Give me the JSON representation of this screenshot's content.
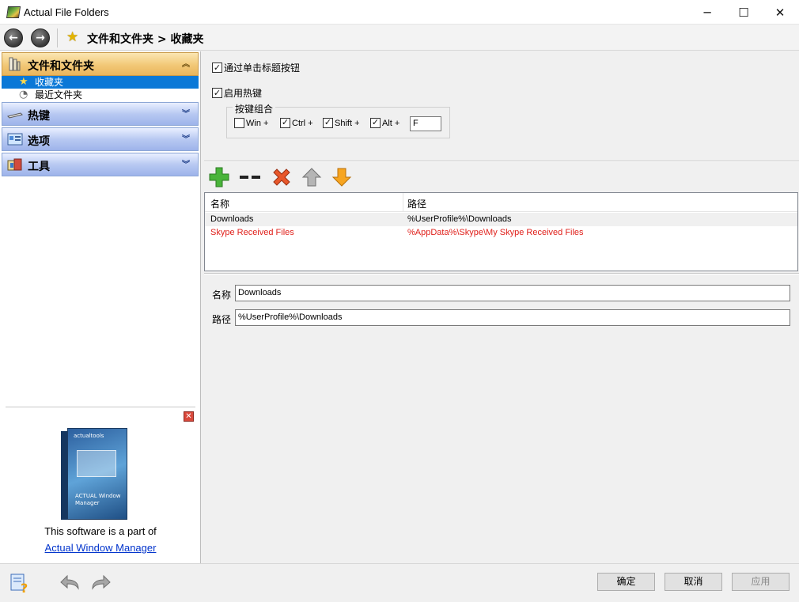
{
  "window": {
    "title": "Actual File Folders",
    "minimize": "─",
    "maximize": "☐",
    "close": "✕"
  },
  "nav": {
    "back_glyph": "←",
    "forward_glyph": "→",
    "breadcrumb": "文件和文件夹 > 收藏夹"
  },
  "sidebar": {
    "categories": [
      {
        "label": "文件和文件夹",
        "icon": "folder-icon",
        "expanded": true
      },
      {
        "label": "热键",
        "icon": "keyboard-icon",
        "expanded": false
      },
      {
        "label": "选项",
        "icon": "options-icon",
        "expanded": false
      },
      {
        "label": "工具",
        "icon": "tools-icon",
        "expanded": false
      }
    ],
    "items": [
      {
        "label": "收藏夹",
        "icon": "star-icon",
        "selected": true
      },
      {
        "label": "最近文件夹",
        "icon": "clock-icon",
        "selected": false
      }
    ],
    "chevron_up": "︽",
    "chevron_down": "︾"
  },
  "promo": {
    "close": "✕",
    "text": "This software is a part of",
    "link": "Actual Window Manager",
    "box_logo": "actualtools",
    "box_title": "ACTUAL Window Manager"
  },
  "settings": {
    "title_button_label": "通过单击标题按钮",
    "title_button_checked": true,
    "hotkey_label": "启用热键",
    "hotkey_checked": true,
    "hotkey_group_label": "按键组合",
    "modifiers": [
      {
        "label": "Win +",
        "checked": false
      },
      {
        "label": "Ctrl +",
        "checked": true
      },
      {
        "label": "Shift +",
        "checked": true
      },
      {
        "label": "Alt +",
        "checked": true
      }
    ],
    "key": "F"
  },
  "table": {
    "columns": [
      "名称",
      "路径"
    ],
    "rows": [
      {
        "name": "Downloads",
        "path": "%UserProfile%\\Downloads",
        "color": "#000000"
      },
      {
        "name": "Skype Received Files",
        "path": "%AppData%\\Skype\\My Skype Received Files",
        "color": "#e0201b"
      }
    ]
  },
  "editor": {
    "name_label": "名称",
    "name_value": "Downloads",
    "path_label": "路径",
    "path_value": "%UserProfile%\\Downloads"
  },
  "buttons": {
    "ok": "确定",
    "cancel": "取消",
    "apply": "应用"
  },
  "check_glyph": "✓"
}
